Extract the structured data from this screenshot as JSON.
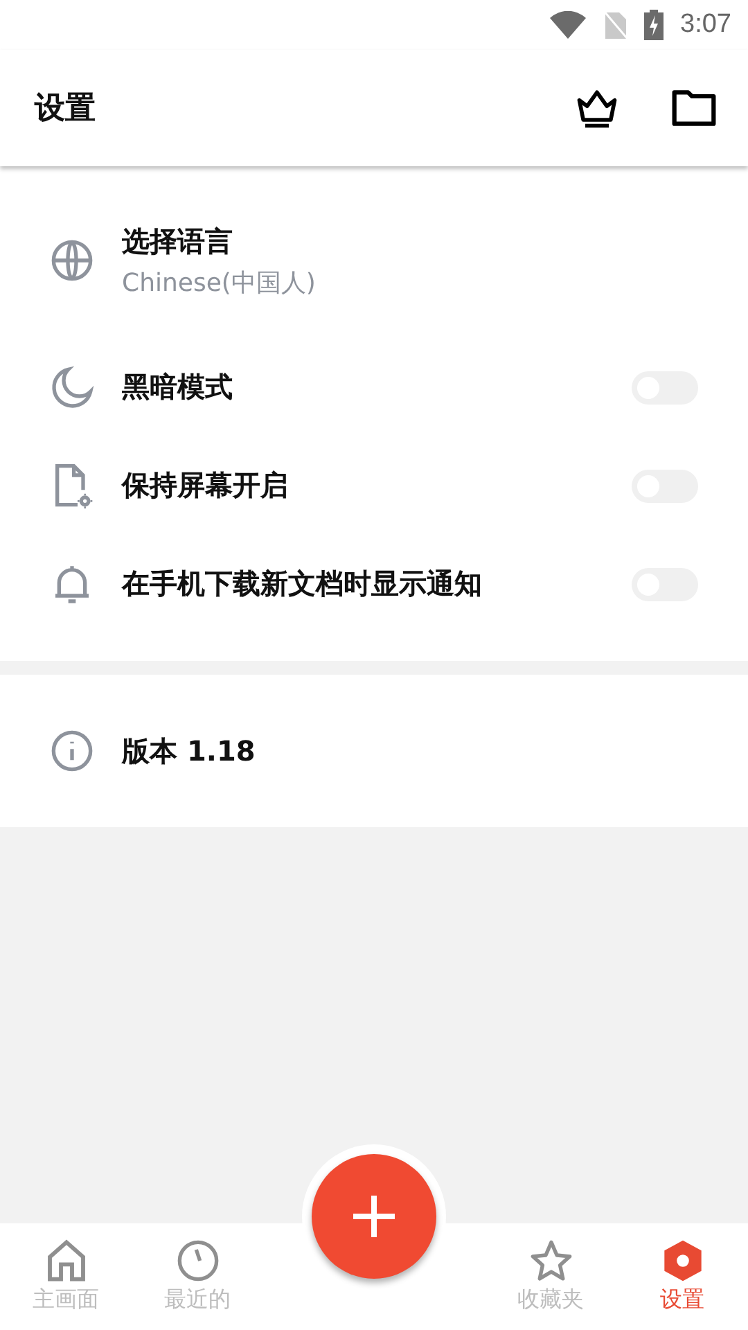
{
  "status_bar": {
    "time": "3:07"
  },
  "app_bar": {
    "title": "设置"
  },
  "settings": [
    {
      "kind": "language",
      "label": "选择语言",
      "value": "Chinese(中国人)"
    },
    {
      "kind": "toggle",
      "label": "黑暗模式",
      "on": false
    },
    {
      "kind": "toggle",
      "label": "保持屏幕开启",
      "on": false
    },
    {
      "kind": "toggle",
      "label": "在手机下载新文档时显示通知",
      "on": false
    }
  ],
  "about": {
    "label": "版本 1.18"
  },
  "bottom_nav": [
    {
      "label": "主画面",
      "selected": false
    },
    {
      "label": "最近的",
      "selected": false
    },
    {
      "label": "收藏夹",
      "selected": false
    },
    {
      "label": "设置",
      "selected": true
    }
  ]
}
